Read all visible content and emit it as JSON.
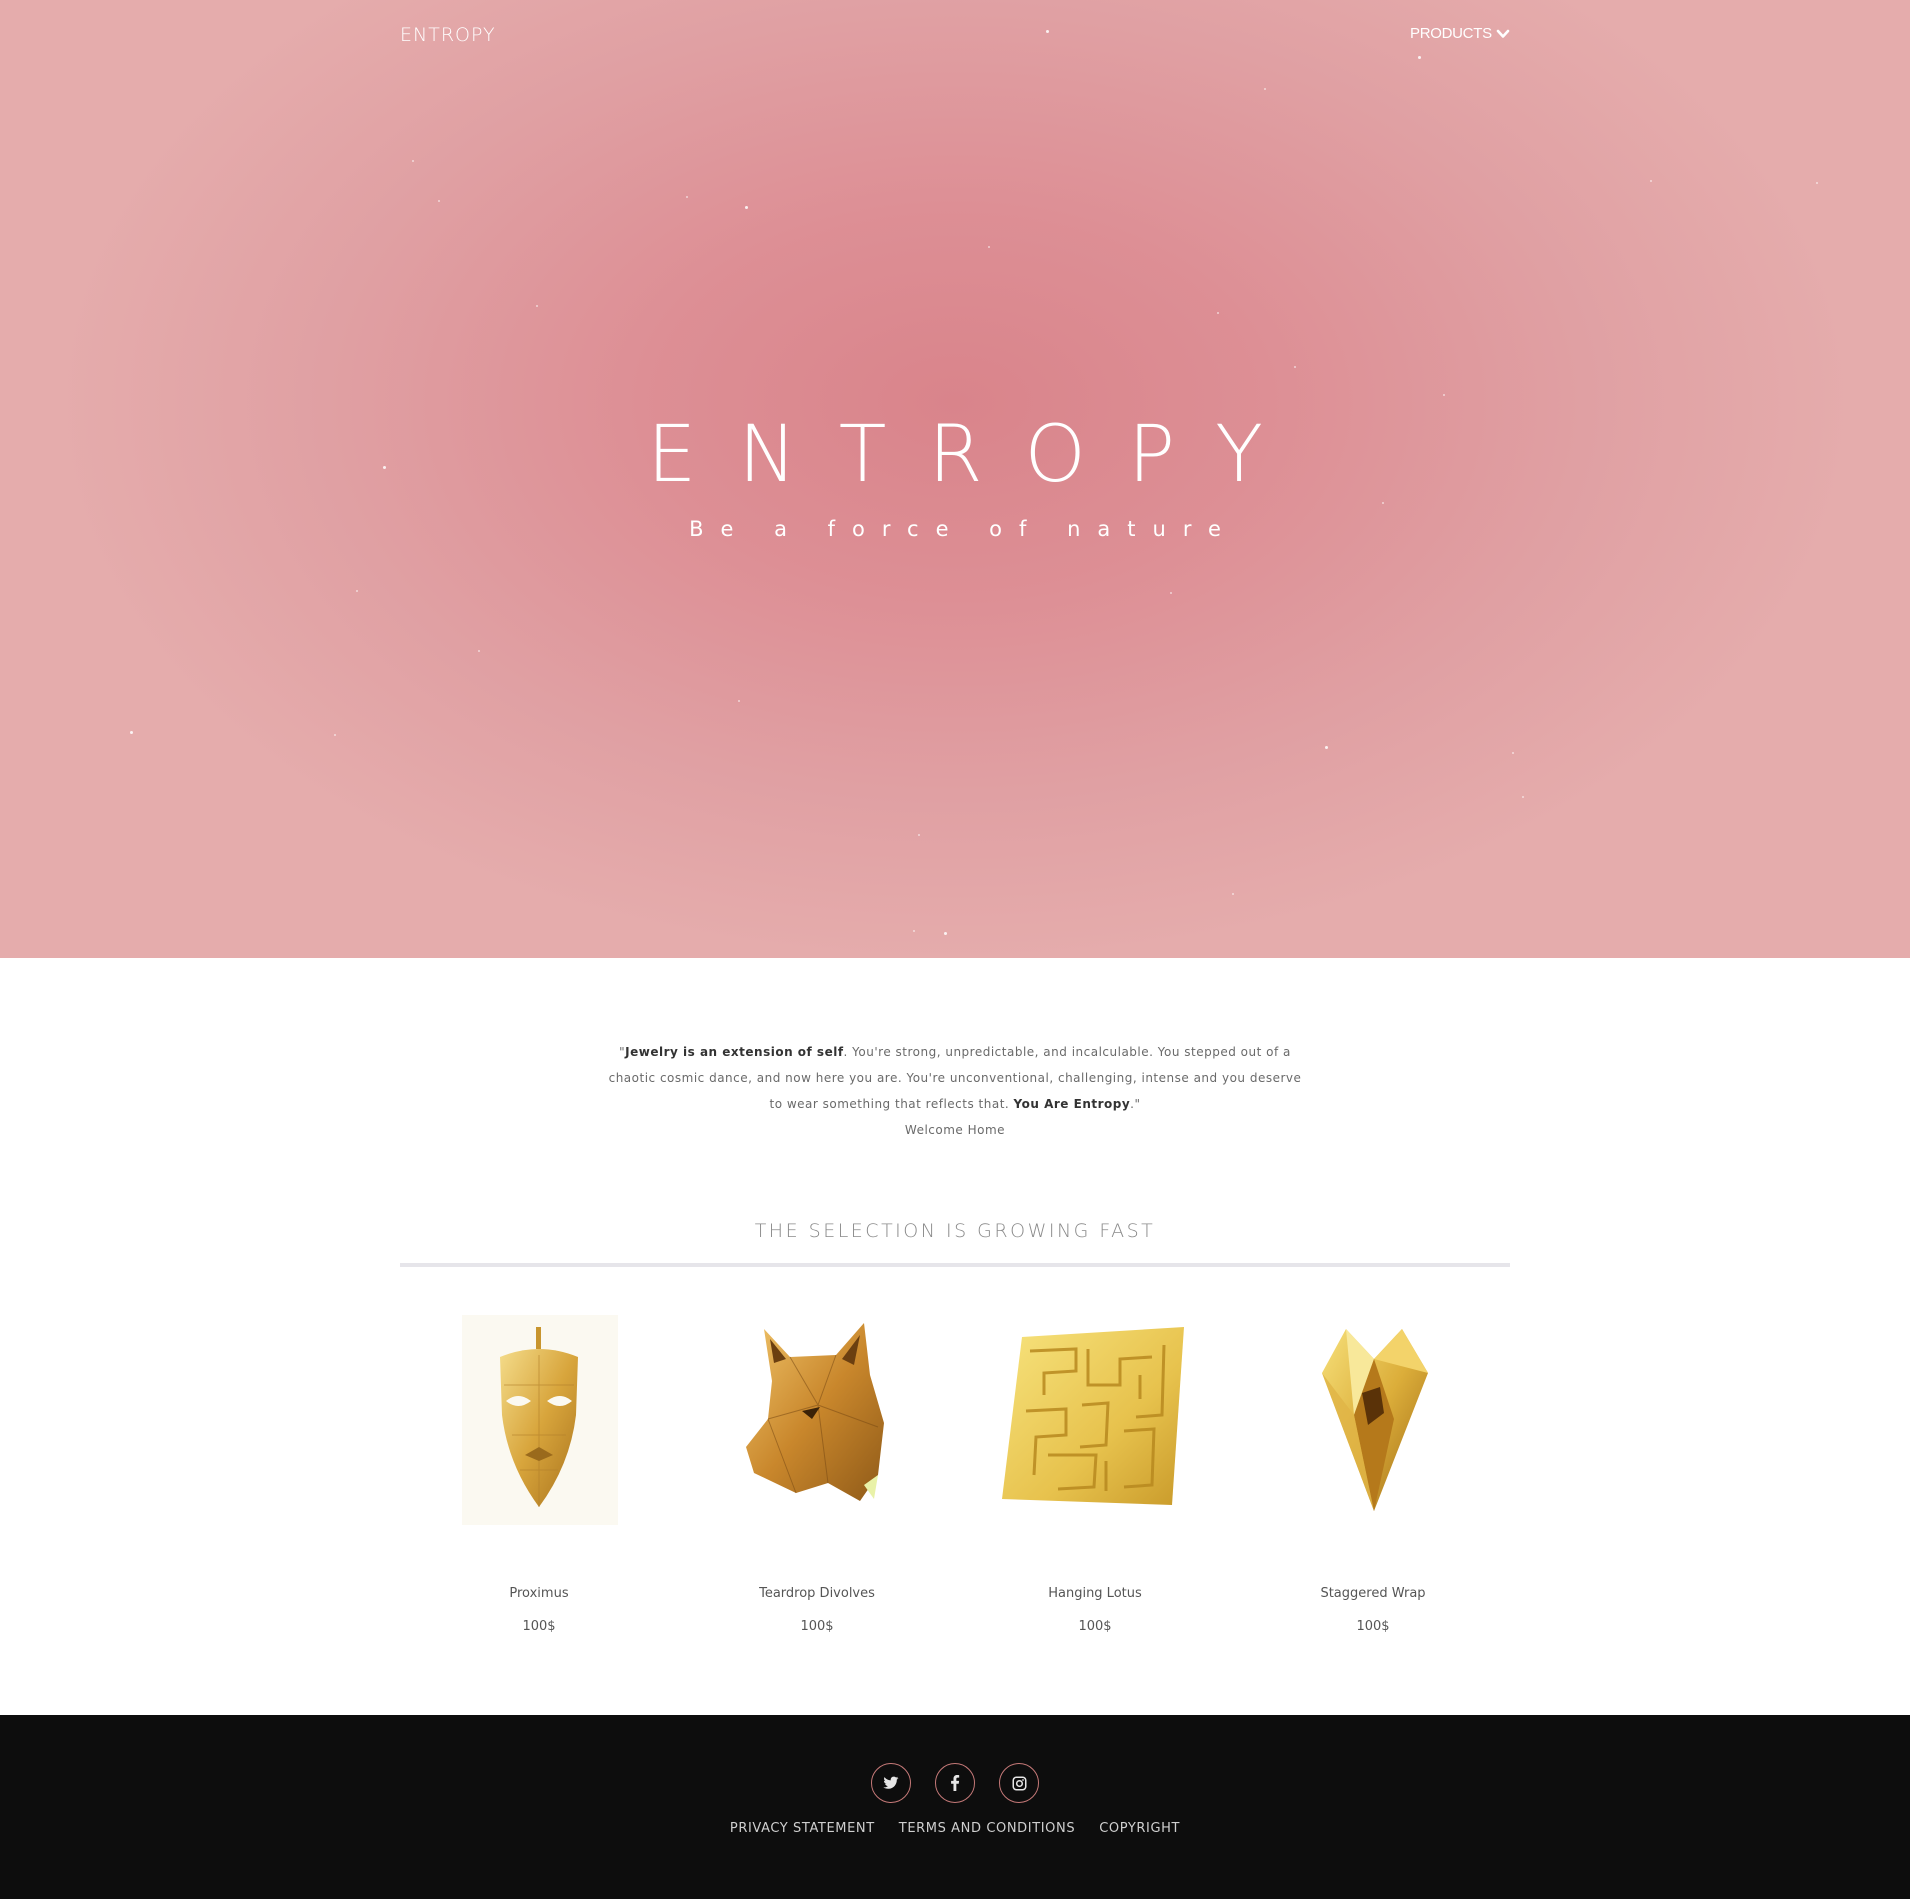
{
  "nav": {
    "brand": "ENTROPY",
    "products_label": "PRODUCTS"
  },
  "hero": {
    "title": "ENTROPY",
    "subtitle": "Be a force of nature"
  },
  "quote": {
    "open_mark": "\"",
    "bold_1": "Jewelry is an extension of self",
    "text_1": ". You're strong, unpredictable, and incalculable. You stepped out of a chaotic cosmic dance, and now here you are. You're unconventional, challenging, intense and you deserve to wear something that reflects that. ",
    "bold_2": "You Are Entropy",
    "close": ".\"",
    "welcome": "Welcome Home"
  },
  "selection": {
    "title": "THE SELECTION IS GROWING FAST",
    "products": [
      {
        "name": "Proximus",
        "price": "100$",
        "icon": "gold-mask-pendant"
      },
      {
        "name": "Teardrop Divolves",
        "price": "100$",
        "icon": "gold-wolf-head-pendant"
      },
      {
        "name": "Hanging Lotus",
        "price": "100$",
        "icon": "gold-maze-pendant"
      },
      {
        "name": "Staggered Wrap",
        "price": "100$",
        "icon": "gold-geometric-heart-pendant"
      }
    ]
  },
  "footer": {
    "social": [
      {
        "name": "twitter",
        "icon": "twitter-icon"
      },
      {
        "name": "facebook",
        "icon": "facebook-icon"
      },
      {
        "name": "instagram",
        "icon": "instagram-icon"
      }
    ],
    "links": [
      "PRIVACY STATEMENT",
      "TERMS AND CONDITIONS",
      "COPYRIGHT"
    ]
  },
  "colors": {
    "hero_pink": "#d9848b",
    "gold": "#d9a93a",
    "footer_bg": "#0d0d0d",
    "social_ring": "#c57978"
  }
}
